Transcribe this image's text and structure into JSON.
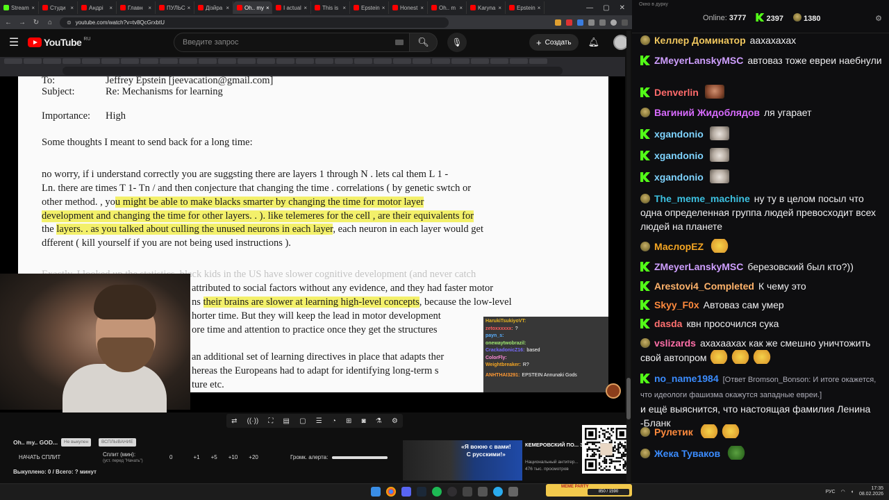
{
  "browser": {
    "tabs": [
      "Stream",
      "Студи",
      "Андрі",
      "Главн",
      "ПУЛЬС",
      "Дізйра",
      "Oh.. my",
      "I actual",
      "This is",
      "Epstein",
      "Honest",
      "Oh.. m",
      "Karyna",
      "Epstein"
    ],
    "active_tab": 6,
    "url": "youtube.com/watch?v=tv8QcGrxbtU"
  },
  "youtube": {
    "logo": "YouTube",
    "region": "RU",
    "search_placeholder": "Введите запрос",
    "create_label": "Создать"
  },
  "document": {
    "to_label": "To:",
    "to_value": "Jeffrey Epstein [jeevacation@gmail.com]",
    "subject_label": "Subject:",
    "subject_value": "Re: Mechanisms for learning",
    "importance_label": "Importance:",
    "importance_value": "High",
    "intro": "Some thoughts I meant to send back for a long time:",
    "p1_l1": "no worry,     if i understand correctly  you are suggsting  there are layers  1 through N .  lets cal them L 1 -",
    "p1_l2": "Ln.   there are times T 1- Tn /     and then conjecture  that changing the time . correlations  ( by genetic swtch or",
    "p1_l3a": "other method. , yo",
    "p1_l3b": "u might be able to make blacks smarter by changing the time for motor layer",
    "p1_l4": "development  and changing the time for other layers. . ).     like telemeres for the cell , are their equivalents for",
    "p1_l5a": "the ",
    "p1_l5b": "layers. . as you talked about culling the unused neurons in each layer",
    "p1_l5c": ",  each neuron in each layer would get",
    "p1_l6": "dfferent  ( kill yourself if you are not being used instructions ).",
    "p2_l1": "Exactly. I looked up the statistics, black kids in the US have slower cognitive development (and never catch",
    "p2_l2": "attributed to social factors without any evidence, and they had faster motor",
    "p2_l3a": "ns ",
    "p2_l3b": "their brains are slower at learning high-level concepts",
    "p2_l3c": ", because the low-level",
    "p2_l4": "horter time. But they will keep the lead in motor development",
    "p2_l5": "ore time and attention to practice once they get the structures",
    "p3_l1": "an additional set of learning directives in place that adapts ther",
    "p3_l2": "hereas the Europeans had to adapt for identifying long-term s",
    "p3_l3": "ture etc."
  },
  "overlay_chat": [
    {
      "user": "HarukiTsukiyoVT:",
      "text": "",
      "color": "#e6b422"
    },
    {
      "user": "zetoxxxxxx:",
      "text": "?",
      "color": "#ff5c5c"
    },
    {
      "user": "payn_s:",
      "text": "",
      "color": "#5ab0ff"
    },
    {
      "user": "onewaytwobrazil:",
      "text": "",
      "color": "#9fe870"
    },
    {
      "user": "CrackadonicZ16:",
      "text": "based",
      "color": "#7a6cff"
    },
    {
      "user": "ColorFly:",
      "text": "",
      "color": "#ff8ad8"
    },
    {
      "user": "Weightbreaker:",
      "text": "R?",
      "color": "#f5a623"
    },
    {
      "user": "ANHTHAI3291:",
      "text": "EPSTEIN Annunaki Gods",
      "color": "#ff9933"
    }
  ],
  "controls_icons": [
    "loop-icon",
    "broadcast-icon",
    "camera-switch-icon",
    "clapper-icon",
    "frame-icon",
    "subtitles-icon",
    "speed-icon",
    "plus-box-icon",
    "screenshot-icon",
    "flask-icon",
    "settings-icon"
  ],
  "panel": {
    "title": "Oh.. my.. GOD...",
    "pill1": "Не выкупен",
    "pill2": "ВСПЛЫВАНИЕ",
    "start_split": "НАЧАТЬ СПЛИТ",
    "split_label": "Сплит (мин):",
    "split_hint": "(уст. перед \"Начать\")",
    "split_value": "0",
    "increments": [
      "+1",
      "+5",
      "+10",
      "+20"
    ],
    "volume_label": "Громк. алерта:",
    "volume_fraction": 1.0,
    "bought": "Выкуплено: 0 / Всего: ? минут"
  },
  "news": {
    "bubble": "«Я воюю с вами!\nС русскими!»",
    "headline": "КЕМЕРОВСКИЙ ПО... ЗАДЕРЖАН ЗА ПО...",
    "channel": "Национальный антитер...",
    "views": "476 тыс. просмотров"
  },
  "memebar": {
    "title": "MEME PARTY",
    "counter": "850 / 1590"
  },
  "tray": {
    "lang": "РУС",
    "time": "17:35",
    "date": "08.02.2026"
  },
  "chat": {
    "popout_label": "Окно в дурку",
    "online_label": "Online:",
    "online_value": "3777",
    "kick_count": "2397",
    "other_count": "1380",
    "messages": [
      {
        "badge": "frog",
        "user": "Келлер Доминатор",
        "color": "#f0c75e",
        "text": "аахахахах",
        "emotes": []
      },
      {
        "badge": "k",
        "user": "ZMeyerLanskyMSC",
        "color": "#cf9fff",
        "text": "автоваз тоже евреи наебнули",
        "emotes": []
      },
      {
        "badge": "k",
        "user": "Denverlin",
        "color": "#ff6b6b",
        "text": "",
        "emotes": [
          "man"
        ]
      },
      {
        "badge": "frog",
        "user": "Вагиний Жидоблядов",
        "color": "#d96bff",
        "text": "ля угарает",
        "emotes": []
      },
      {
        "badge": "k",
        "user": "xgandonio",
        "color": "#7fd4ff",
        "text": "",
        "emotes": [
          "cat"
        ]
      },
      {
        "badge": "k",
        "user": "xgandonio",
        "color": "#7fd4ff",
        "text": "",
        "emotes": [
          "cat"
        ]
      },
      {
        "badge": "k",
        "user": "xgandonio",
        "color": "#7fd4ff",
        "text": "",
        "emotes": [
          "cat"
        ]
      },
      {
        "badge": "frog",
        "user": "The_meme_machine",
        "color": "#3cc0e0",
        "text": "ну ту в целом посыл что одна определенная группа людей превосходит всех людей на планете",
        "emotes": []
      },
      {
        "badge": "frog",
        "user": "МаслорEZ",
        "color": "#f5a623",
        "text": "",
        "emotes": [
          "smile"
        ]
      },
      {
        "badge": "k",
        "user": "ZMeyerLanskyMSC",
        "color": "#cf9fff",
        "text": "березовский был кто?))",
        "emotes": []
      },
      {
        "badge": "k",
        "user": "Arestovi4_Completed",
        "color": "#ffb36b",
        "text": "К чему это",
        "emotes": []
      },
      {
        "badge": "k",
        "user": "Skyy_F0x",
        "color": "#ff8a3d",
        "text": "Автоваз сам умер",
        "emotes": []
      },
      {
        "badge": "k",
        "user": "dasda",
        "color": "#ff7070",
        "text": "квн просочился сука",
        "emotes": []
      },
      {
        "badge": "frog",
        "user": "vslizards",
        "color": "#ff6fa8",
        "text": "ахахаахах как же смешно уничтожить свой автопром",
        "emotes": [
          "smile",
          "smile",
          "smile"
        ]
      },
      {
        "badge": "k",
        "user": "no_name1984",
        "color": "#3b8cff",
        "reply": "[Ответ Bromson_Bonson: И итоге окажется, что идеологи фашизма окажутся западные евреи.]",
        "text": "и ещё выяснится, что настоящая фамилия Ленина -Бланк",
        "emotes": []
      },
      {
        "badge": "frog",
        "user": "Рулетик",
        "color": "#ff8a3d",
        "text": "",
        "emotes": [
          "smile",
          "smile"
        ]
      },
      {
        "badge": "frog",
        "user": "Жека Туваков",
        "color": "#3b8cff",
        "text": "",
        "emotes": [
          "pepe"
        ]
      }
    ]
  }
}
